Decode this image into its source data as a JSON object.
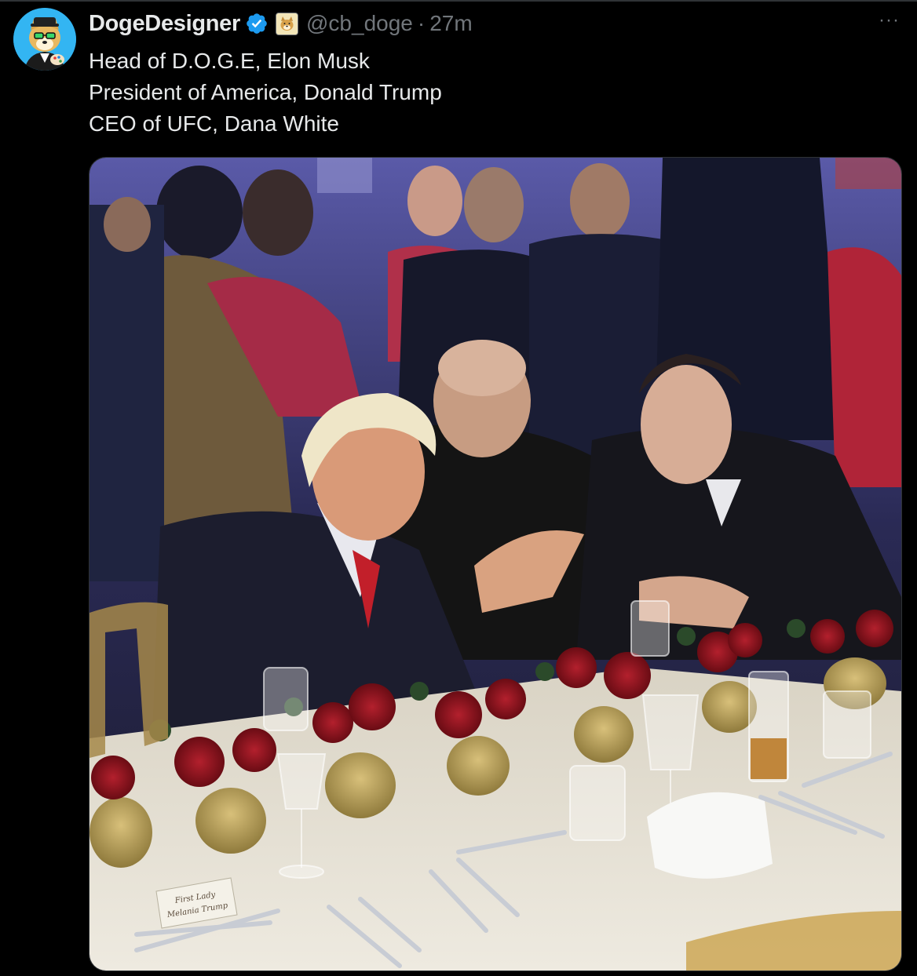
{
  "author": {
    "display_name": "DogeDesigner",
    "handle": "@cb_doge",
    "separator": "·",
    "time": "27m",
    "avatar_icon": "doge-avatar",
    "verified_icon": "verified-badge-icon",
    "affiliation_icon": "doge-affiliate-badge-icon"
  },
  "more_label": "···",
  "tweet": {
    "lines": [
      "Head of D.O.G.E, Elon Musk",
      "President of America, Donald Trump",
      "CEO of UFC, Dana White"
    ]
  },
  "media": {
    "place_card_text": [
      "First Lady",
      "Melania Trump"
    ]
  },
  "colors": {
    "background": "#000000",
    "text_primary": "#e7e9ea",
    "text_secondary": "#71767b",
    "verified": "#1d9bf0",
    "border": "#2f3336"
  }
}
